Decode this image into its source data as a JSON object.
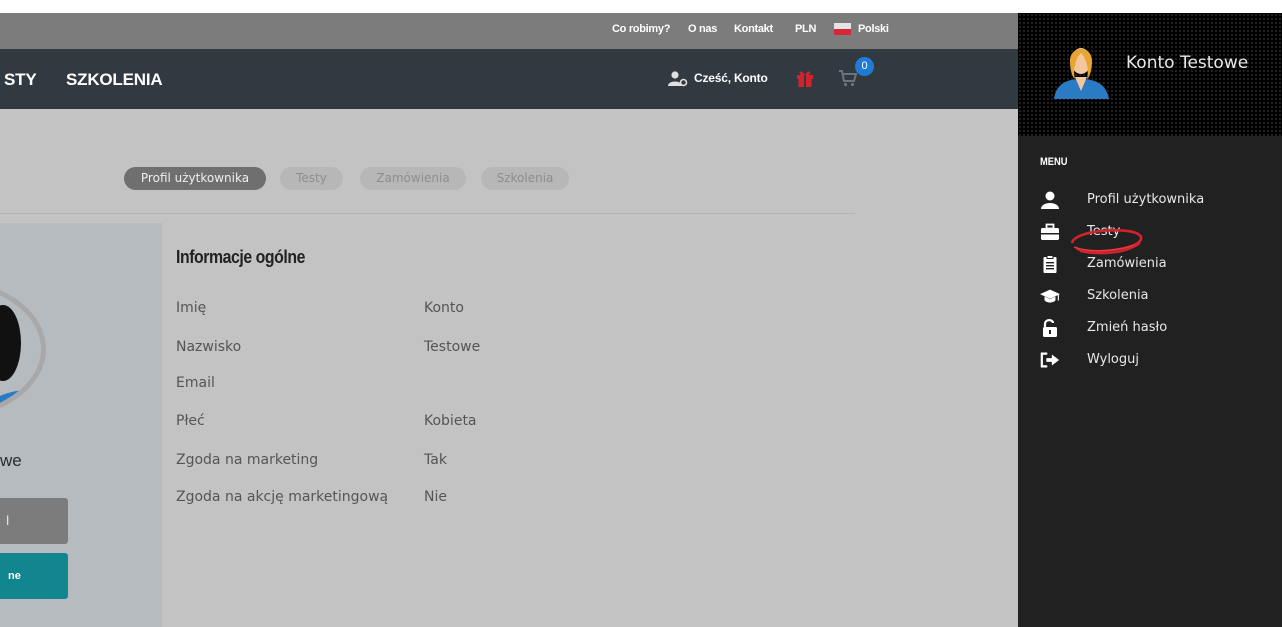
{
  "topbar": {
    "links": [
      "Co robimy?",
      "O nas",
      "Kontakt",
      "PLN"
    ],
    "language": "Polski"
  },
  "navbar": {
    "items": [
      "STY",
      "SZKOLENIA"
    ],
    "greeting": "Cześć, Konto",
    "cart_count": "0"
  },
  "tabs": [
    {
      "label": "Profil użytkownika",
      "active": true
    },
    {
      "label": "Testy",
      "active": false
    },
    {
      "label": "Zamówienia",
      "active": false
    },
    {
      "label": "Szkolenia",
      "active": false
    }
  ],
  "left_panel": {
    "name_fragment": "we",
    "button1": "l",
    "button2": "ne"
  },
  "profile": {
    "section_title": "Informacje ogólne",
    "rows": [
      {
        "label": "Imię",
        "value": "Konto"
      },
      {
        "label": "Nazwisko",
        "value": "Testowe"
      },
      {
        "label": "Email",
        "value": ""
      },
      {
        "label": "Płeć",
        "value": "Kobieta"
      },
      {
        "label": "Zgoda na marketing",
        "value": "Tak"
      },
      {
        "label": "Zgoda na akcję marketingową",
        "value": "Nie"
      }
    ]
  },
  "sidebar": {
    "user_name": "Konto Testowe",
    "menu_title": "MENU",
    "items": [
      {
        "label": "Profil użytkownika",
        "icon": "user-icon"
      },
      {
        "label": "Testy",
        "icon": "briefcase-icon"
      },
      {
        "label": "Zamówienia",
        "icon": "clipboard-icon"
      },
      {
        "label": "Szkolenia",
        "icon": "graduation-cap-icon"
      },
      {
        "label": "Zmień hasło",
        "icon": "unlock-icon"
      },
      {
        "label": "Wyloguj",
        "icon": "sign-out-icon"
      }
    ]
  },
  "colors": {
    "navbar": "#323a41",
    "sidebar": "#212121",
    "accent_teal": "#12868f",
    "badge_blue": "#1f7bd6",
    "highlight_red": "#d4232e"
  }
}
